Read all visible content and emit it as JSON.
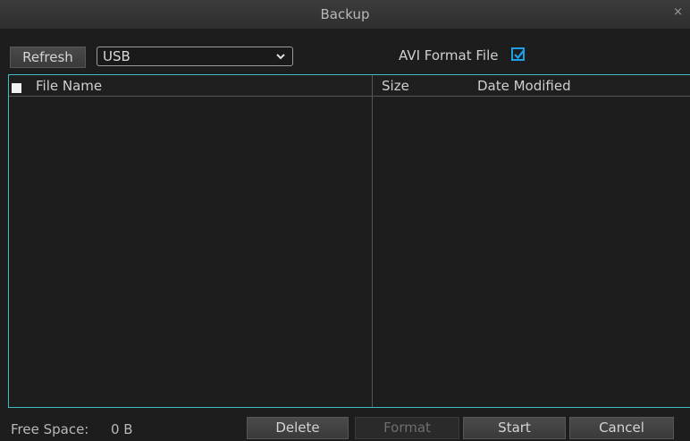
{
  "window": {
    "title": "Backup",
    "close_glyph": "×"
  },
  "toolbar": {
    "refresh_label": "Refresh",
    "device_selected": "USB",
    "avi_label": "AVI Format File",
    "avi_checked": true
  },
  "table": {
    "columns": [
      "File Name",
      "Size",
      "Date Modified"
    ],
    "rows": []
  },
  "footer": {
    "free_space_label": "Free Space:",
    "free_space_value": "0 B",
    "delete_label": "Delete",
    "format_label": "Format",
    "start_label": "Start",
    "cancel_label": "Cancel"
  },
  "icons": {
    "close": "close-icon",
    "dropdown": "chevron-down-icon",
    "checkbox": "checkmark-icon"
  },
  "colors": {
    "background": "#1d1d1d",
    "accent_border": "#3fbcc5",
    "checkbox": "#1e9fe6"
  }
}
